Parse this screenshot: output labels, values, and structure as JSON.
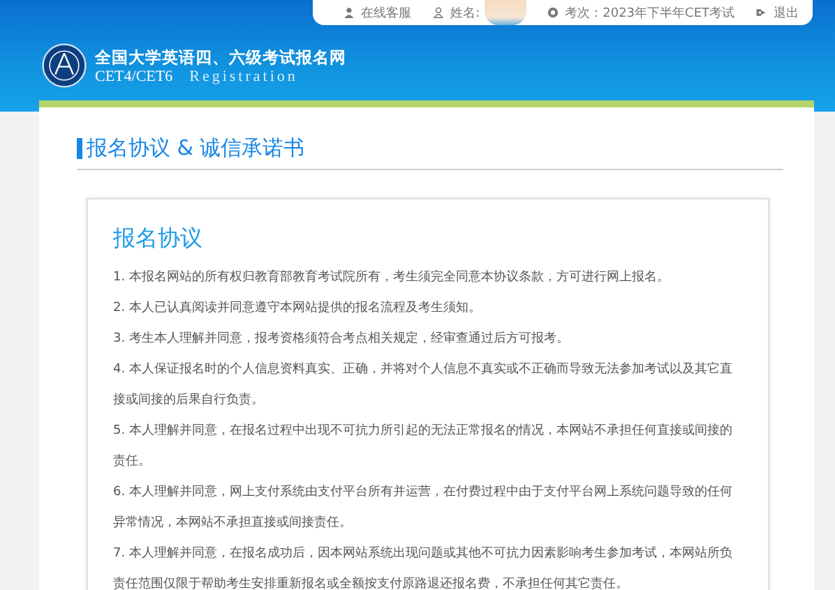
{
  "top_bar": {
    "service_link": "在线客服",
    "name_label": "姓名:",
    "exam_label": "考次：2023年下半年CET考试",
    "logout_link": "退出"
  },
  "site": {
    "title": "全国大学英语四、六级考试报名网",
    "subtitle": "CET4/CET6",
    "subtitle_en": "Registration"
  },
  "page_title": "报名协议 & 诚信承诺书",
  "agreement": {
    "title": "报名协议",
    "items": [
      "1. 本报名网站的所有权归教育部教育考试院所有，考生须完全同意本协议条款，方可进行网上报名。",
      "2. 本人已认真阅读并同意遵守本网站提供的报名流程及考生须知。",
      "3. 考生本人理解并同意，报考资格须符合考点相关规定，经审查通过后方可报考。",
      "4. 本人保证报名时的个人信息资料真实、正确，并将对个人信息不真实或不正确而导致无法参加考试以及其它直接或间接的后果自行负责。",
      "5. 本人理解并同意，在报名过程中出现不可抗力所引起的无法正常报名的情况，本网站不承担任何直接或间接的责任。",
      "6. 本人理解并同意，网上支付系统由支付平台所有并运营，在付费过程中由于支付平台网上系统问题导致的任何异常情况，本网站不承担直接或间接责任。",
      "7. 本人理解并同意，在报名成功后，因本网站系统出现问题或其他不可抗力因素影响考生参加考试，本网站所负责任范围仅限于帮助考生安排重新报名或全额按支付原路退还报名费，不承担任何其它责任。"
    ]
  }
}
